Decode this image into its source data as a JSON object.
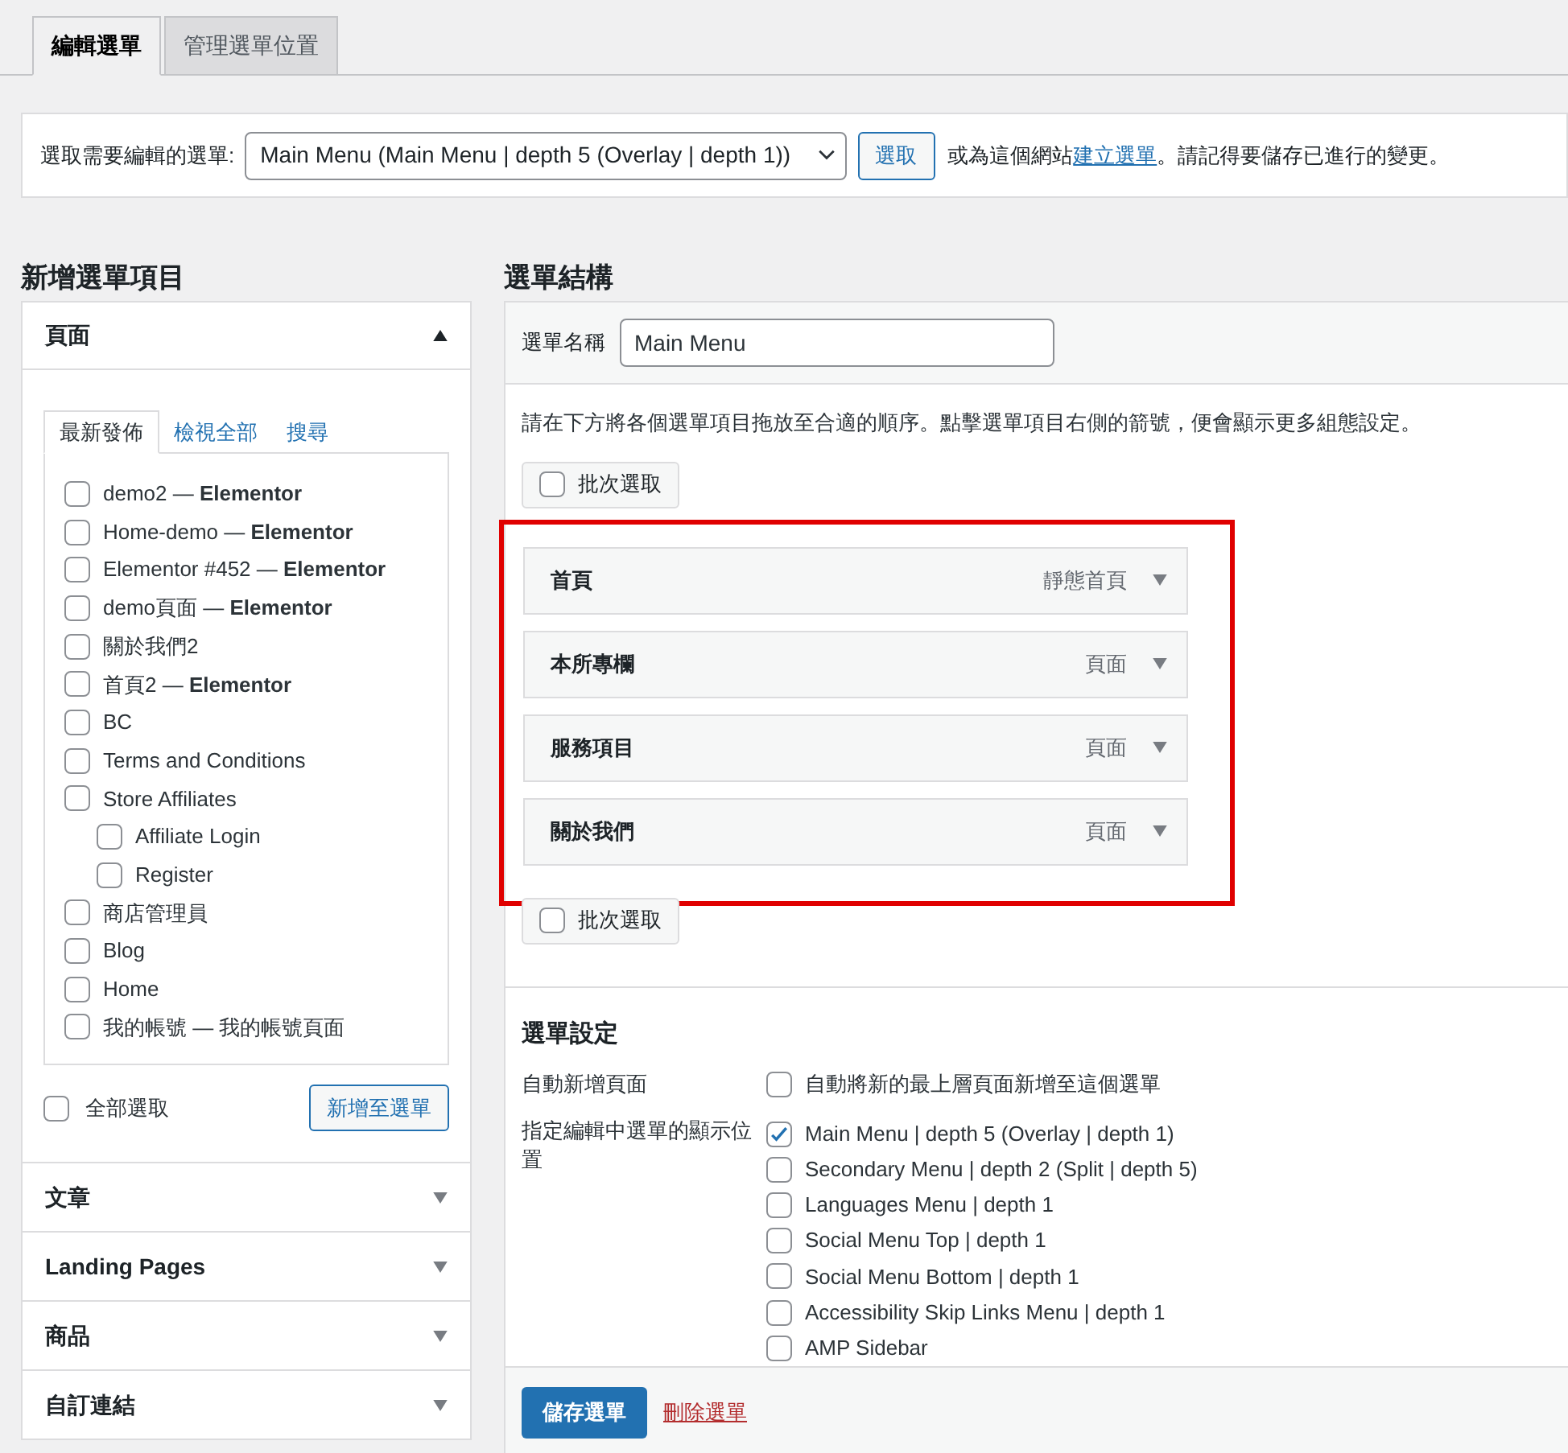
{
  "tabs": [
    {
      "label": "編輯選單",
      "selected": true
    },
    {
      "label": "管理選單位置",
      "selected": false
    }
  ],
  "menu_selector": {
    "label": "選取需要編輯的選單:",
    "value": "Main Menu (Main Menu | depth 5 (Overlay | depth 1))",
    "button": "選取",
    "note_before": "或為這個網站",
    "link": "建立選單",
    "note_after": "。請記得要儲存已進行的變更。"
  },
  "add_items": {
    "title": "新增選單項目",
    "sections": [
      {
        "title": "頁面",
        "expanded": true
      },
      {
        "title": "文章",
        "expanded": false
      },
      {
        "title": "Landing Pages",
        "expanded": false
      },
      {
        "title": "商品",
        "expanded": false
      },
      {
        "title": "自訂連結",
        "expanded": false
      }
    ],
    "page_tabs": [
      {
        "label": "最新發佈",
        "selected": true
      },
      {
        "label": "檢視全部",
        "selected": false
      },
      {
        "label": "搜尋",
        "selected": false
      }
    ],
    "pages": [
      {
        "label": "demo2 — **Elementor**",
        "checked": false
      },
      {
        "label": "Home-demo — **Elementor**",
        "checked": false
      },
      {
        "label": "Elementor #452 — **Elementor**",
        "checked": false
      },
      {
        "label": "demo頁面 — **Elementor**",
        "checked": false
      },
      {
        "label": "關於我們2",
        "checked": false
      },
      {
        "label": "首頁2 — **Elementor**",
        "checked": false
      },
      {
        "label": "BC",
        "checked": false
      },
      {
        "label": "Terms and Conditions",
        "checked": false
      },
      {
        "label": "Store Affiliates",
        "checked": false,
        "children": [
          {
            "label": "Affiliate Login",
            "checked": false
          },
          {
            "label": "Register",
            "checked": false
          }
        ]
      },
      {
        "label": "商店管理員",
        "checked": false
      },
      {
        "label": "Blog",
        "checked": false
      },
      {
        "label": "Home",
        "checked": false
      },
      {
        "label": "我的帳號 — 我的帳號頁面",
        "checked": false
      }
    ],
    "select_all": {
      "label": "全部選取",
      "checked": false
    },
    "add_button": "新增至選單"
  },
  "structure": {
    "title": "選單結構",
    "name_label": "選單名稱",
    "name_value": "Main Menu",
    "instructions": "請在下方將各個選單項目拖放至合適的順序。點擊選單項目右側的箭號，便會顯示更多組態設定。",
    "bulk_select_top": {
      "label": "批次選取",
      "checked": false
    },
    "items": [
      {
        "title": "首頁",
        "type": "靜態首頁"
      },
      {
        "title": "本所專欄",
        "type": "頁面"
      },
      {
        "title": "服務項目",
        "type": "頁面"
      },
      {
        "title": "關於我們",
        "type": "頁面"
      }
    ],
    "bulk_select_bottom": {
      "label": "批次選取",
      "checked": false
    },
    "settings": {
      "title": "選單設定",
      "auto_add_label": "自動新增頁面",
      "auto_add_option": {
        "label": "自動將新的最上層頁面新增至這個選單",
        "checked": false
      },
      "locations_label": "指定編輯中選單的顯示位置",
      "locations": [
        {
          "label": "Main Menu | depth 5 (Overlay | depth 1)",
          "checked": true
        },
        {
          "label": "Secondary Menu | depth 2 (Split | depth 5)",
          "checked": false
        },
        {
          "label": "Languages Menu | depth 1",
          "checked": false
        },
        {
          "label": "Social Menu Top | depth 1",
          "checked": false
        },
        {
          "label": "Social Menu Bottom | depth 1",
          "checked": false
        },
        {
          "label": "Accessibility Skip Links Menu | depth 1",
          "checked": false
        },
        {
          "label": "AMP Sidebar",
          "checked": false
        }
      ]
    },
    "save_button": "儲存選單",
    "delete_link": "刪除選單"
  }
}
